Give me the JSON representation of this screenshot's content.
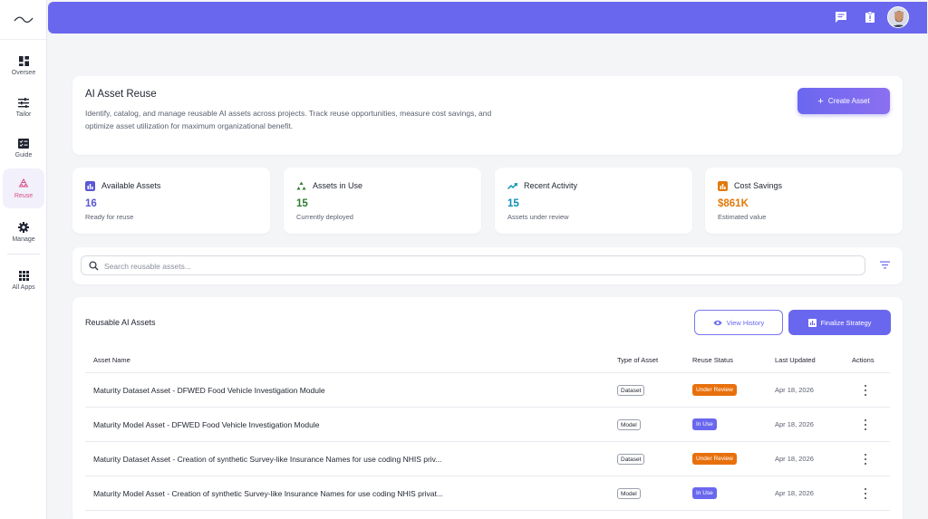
{
  "sidebar": {
    "items": [
      {
        "label": "Oversee"
      },
      {
        "label": "Tailor"
      },
      {
        "label": "Guide"
      },
      {
        "label": "Reuse"
      },
      {
        "label": "Manage"
      },
      {
        "label": "All Apps"
      }
    ],
    "active": "Reuse"
  },
  "header": {
    "title": "AI Asset Reuse",
    "description": "Identify, catalog, and manage reusable AI assets across projects. Track reuse opportunities, measure cost savings, and optimize asset utilization for maximum organizational benefit.",
    "create_label": "Create Asset"
  },
  "stats": [
    {
      "title": "Available Assets",
      "value": "16",
      "sub": "Ready for reuse",
      "color": "#5b57d6"
    },
    {
      "title": "Assets in Use",
      "value": "15",
      "sub": "Currently deployed",
      "color": "#2e7d32"
    },
    {
      "title": "Recent Activity",
      "value": "15",
      "sub": "Assets under review",
      "color": "#0b8fb3"
    },
    {
      "title": "Cost Savings",
      "value": "$861K",
      "sub": "Estimated value",
      "color": "#e07a0a"
    }
  ],
  "search": {
    "placeholder": "Search reusable assets..."
  },
  "table": {
    "title": "Reusable AI Assets",
    "view_history_label": "View History",
    "finalize_label": "Finalize Strategy",
    "columns": [
      "Asset Name",
      "Type of Asset",
      "Reuse Status",
      "Last Updated",
      "Actions"
    ],
    "rows": [
      {
        "name": "Maturity Dataset Asset - DFWED Food Vehicle Investigation Module",
        "type": "Dataset",
        "status": "Under Review",
        "date": "Apr 18, 2026"
      },
      {
        "name": "Maturity Model Asset - DFWED Food Vehicle Investigation Module",
        "type": "Model",
        "status": "In Use",
        "date": "Apr 18, 2026"
      },
      {
        "name": "Maturity Dataset Asset - Creation of synthetic Survey-like Insurance Names for use coding NHIS priv...",
        "type": "Dataset",
        "status": "Under Review",
        "date": "Apr 18, 2026"
      },
      {
        "name": "Maturity Model Asset - Creation of synthetic Survey-like Insurance Names for use coding NHIS privat...",
        "type": "Model",
        "status": "In Use",
        "date": "Apr 18, 2026"
      }
    ]
  },
  "colors": {
    "accent": "#6a67ef",
    "under_review": "#e8700c",
    "in_use": "#6a67ef"
  }
}
